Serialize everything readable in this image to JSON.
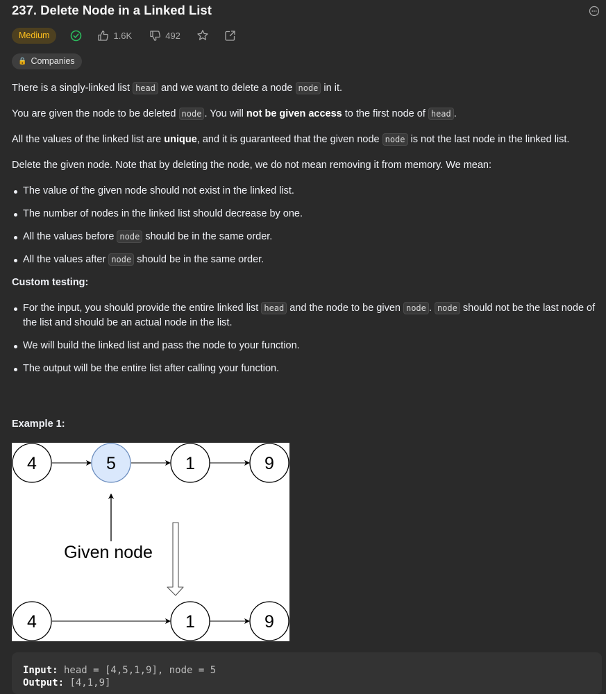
{
  "problem": {
    "title": "237. Delete Node in a Linked List",
    "difficulty": "Medium",
    "likes": "1.6K",
    "dislikes": "492",
    "companies_label": "Companies"
  },
  "description": {
    "p1": [
      "There is a singly-linked list ",
      "head",
      " and we want to delete a node ",
      "node",
      " in it."
    ],
    "p2": [
      "You are given the node to be deleted ",
      "node",
      ". You will ",
      "not be given access",
      " to the first node of ",
      "head",
      "."
    ],
    "p3": [
      "All the values of the linked list are ",
      "unique",
      ", and it is guaranteed that the given node ",
      "node",
      " is not the last node in the linked list."
    ],
    "p4": "Delete the given node. Note that by deleting the node, we do not mean removing it from memory. We mean:",
    "bullets": [
      "The value of the given node should not exist in the linked list.",
      "The number of nodes in the linked list should decrease by one.",
      [
        "All the values before ",
        "node",
        " should be in the same order."
      ],
      [
        "All the values after ",
        "node",
        " should be in the same order."
      ]
    ],
    "custom_testing_heading": "Custom testing:",
    "custom_bullets": [
      [
        "For the input, you should provide the entire linked list ",
        "head",
        " and the node to be given ",
        "node",
        ". ",
        "node",
        " should not be the last node of the list and should be an actual node in the list."
      ],
      "We will build the linked list and pass the node to your function.",
      "The output will be the entire list after calling your function."
    ]
  },
  "example1": {
    "heading": "Example 1:",
    "diagram": {
      "top_nodes": [
        "4",
        "5",
        "1",
        "9"
      ],
      "bottom_nodes": [
        "4",
        "1",
        "9"
      ],
      "label": "Given node",
      "highlight_color": "#dae8fc"
    },
    "input_label": "Input:",
    "input_value": " head = [4,5,1,9], node = 5",
    "output_label": "Output:",
    "output_value": " [4,1,9]"
  },
  "colors": {
    "background": "#2a2a2a",
    "medium": "#ffc01e",
    "solved": "#2cbb5d"
  }
}
